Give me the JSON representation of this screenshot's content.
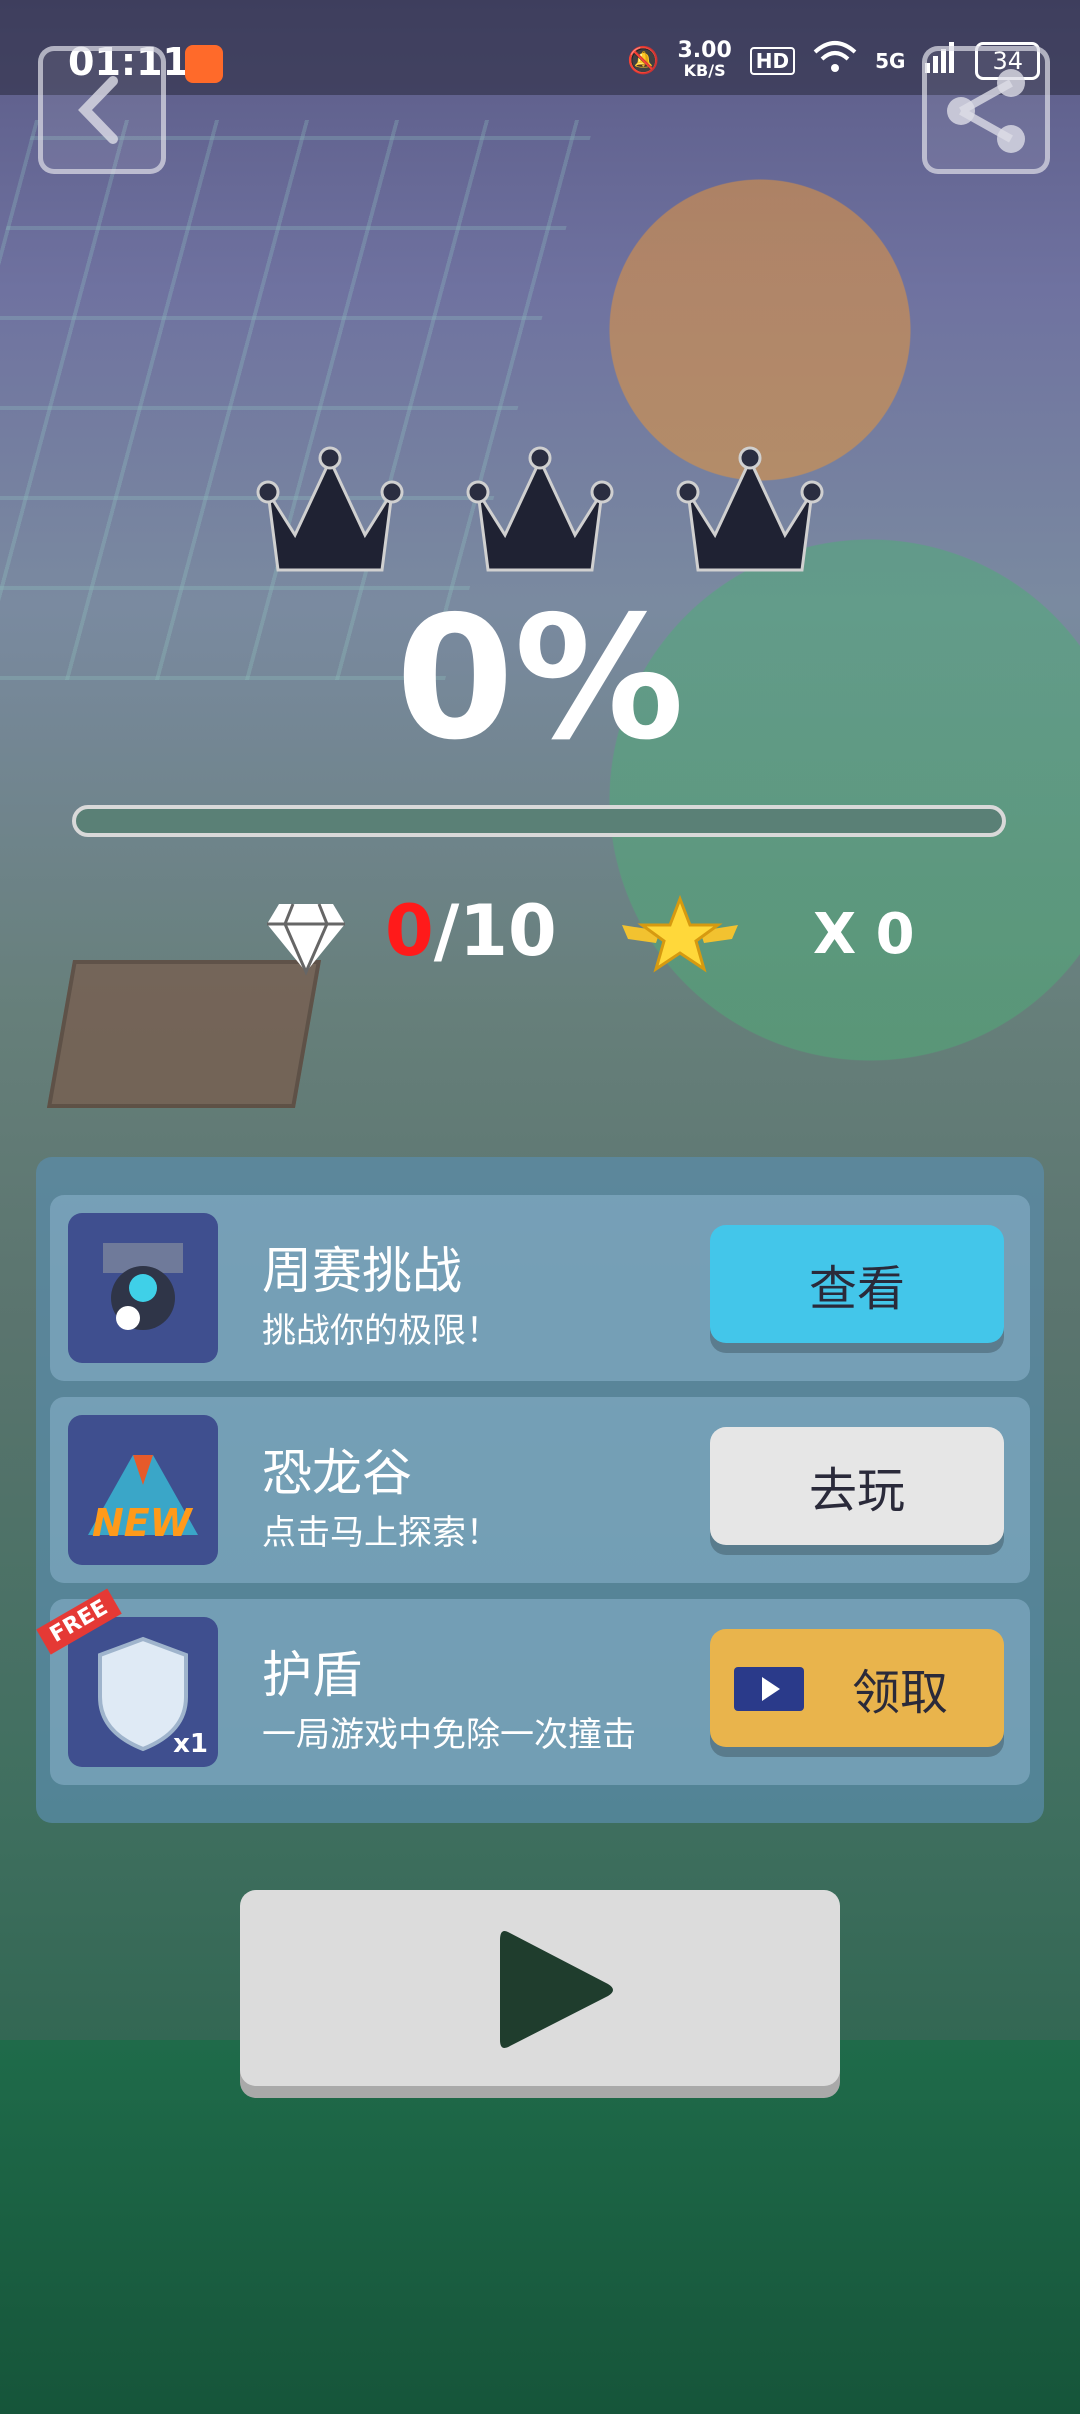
{
  "status_bar": {
    "time": "01:11",
    "net_speed_value": "3.00",
    "net_speed_unit": "KB/S",
    "hd": "HD",
    "network": "5G",
    "battery": "34"
  },
  "level": {
    "crowns_earned": 0,
    "crowns_total": 3,
    "percent_label": "0%",
    "progress_fraction": 0
  },
  "stats": {
    "gems_current": "0",
    "gems_total": "/10",
    "stars_label": "X 0"
  },
  "panel": {
    "items": [
      {
        "title": "周赛挑战",
        "subtitle": "挑战你的极限！",
        "button": "查看",
        "icon": "robot-icon",
        "button_color": "#43c6ea"
      },
      {
        "title": "恐龙谷",
        "subtitle": "点击马上探索！",
        "button": "去玩",
        "icon": "volcano-new-icon",
        "badge": "NEW",
        "button_color": "#e6e6e6"
      },
      {
        "title": "护盾",
        "subtitle": "一局游戏中免除一次撞击",
        "button": "领取",
        "icon": "shield-icon",
        "free_tag": "FREE",
        "count_tag": "x1",
        "button_color": "#e9b44c"
      }
    ]
  },
  "colors": {
    "accent_red": "#ff1a1a",
    "panel": "#5a8caa"
  }
}
